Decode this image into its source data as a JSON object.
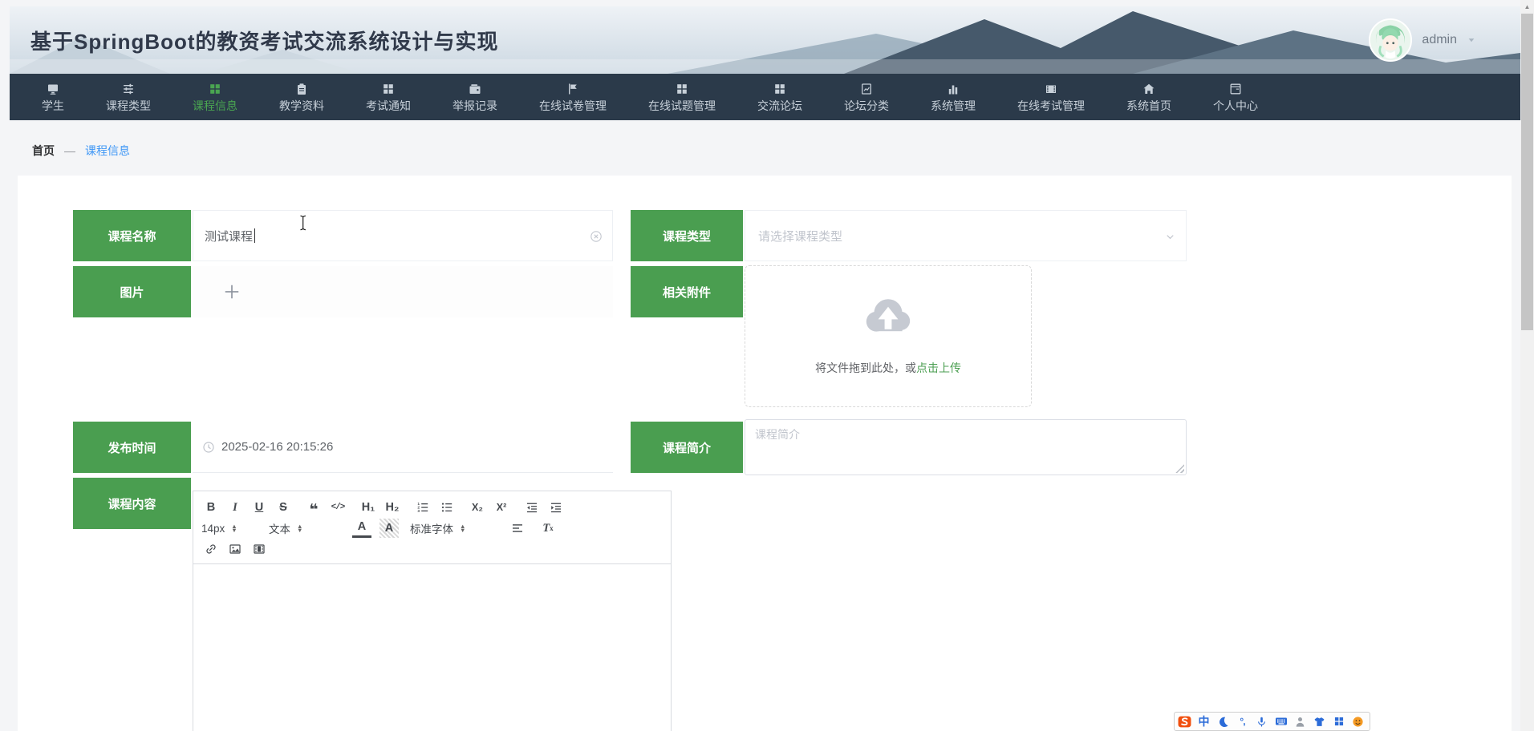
{
  "header": {
    "title": "基于SpringBoot的教资考试交流系统设计与实现",
    "user": {
      "name": "admin",
      "avatar_icon": "avatar",
      "menu_icon": "caret-down"
    }
  },
  "nav": {
    "items": [
      {
        "label": "学生",
        "icon": "monitor",
        "active": false
      },
      {
        "label": "课程类型",
        "icon": "sliders",
        "active": false
      },
      {
        "label": "课程信息",
        "icon": "grid",
        "active": true
      },
      {
        "label": "教学资料",
        "icon": "clipboard",
        "active": false
      },
      {
        "label": "考试通知",
        "icon": "grid",
        "active": false
      },
      {
        "label": "举报记录",
        "icon": "wallet",
        "active": false
      },
      {
        "label": "在线试卷管理",
        "icon": "flag",
        "active": false
      },
      {
        "label": "在线试题管理",
        "icon": "grid",
        "active": false
      },
      {
        "label": "交流论坛",
        "icon": "grid",
        "active": false
      },
      {
        "label": "论坛分类",
        "icon": "docchart",
        "active": false
      },
      {
        "label": "系统管理",
        "icon": "barchart",
        "active": false
      },
      {
        "label": "在线考试管理",
        "icon": "film",
        "active": false
      },
      {
        "label": "系统首页",
        "icon": "home",
        "active": false
      },
      {
        "label": "个人中心",
        "icon": "card",
        "active": false
      }
    ]
  },
  "breadcrumb": {
    "home": "首页",
    "separator": "—",
    "current": "课程信息"
  },
  "form": {
    "course_name": {
      "label": "课程名称",
      "value": "测试课程",
      "clear_icon": "clear"
    },
    "course_type": {
      "label": "课程类型",
      "placeholder": "请选择课程类型",
      "chevron_icon": "chevron-down"
    },
    "image": {
      "label": "图片",
      "plus_icon": "plus"
    },
    "attachment": {
      "label": "相关附件",
      "icon": "cloud-upload",
      "drop_text": "将文件拖到此处，或",
      "upload_link": "点击上传"
    },
    "publish_time": {
      "label": "发布时间",
      "value": "2025-02-16 20:15:26",
      "icon": "clock"
    },
    "course_intro": {
      "label": "课程简介",
      "placeholder": "课程简介"
    },
    "course_content": {
      "label": "课程内容"
    }
  },
  "editor": {
    "toolbar": {
      "bold": "B",
      "italic": "I",
      "underline": "U",
      "strike": "S",
      "blockquote": "❝",
      "code": "</>",
      "header1": "H₁",
      "header2": "H₂",
      "ordered_list_icon": "olist",
      "bullet_list_icon": "ulist",
      "subscript": "X₂",
      "superscript": "X²",
      "outdent_icon": "outdent",
      "indent_icon": "indent",
      "size_value": "14px",
      "header_value": "文本",
      "font_value": "标准字体",
      "color_glyph": "A",
      "background_glyph": "A",
      "align_icon": "align",
      "clean_main": "T",
      "clean_sub": "x",
      "link_icon": "link",
      "image_icon": "image",
      "video_icon": "video"
    }
  },
  "ime": {
    "items": [
      {
        "icon": "sogou"
      },
      {
        "label": "中"
      },
      {
        "icon": "moon"
      },
      {
        "label": "°,"
      },
      {
        "icon": "mic"
      },
      {
        "icon": "keyboard"
      },
      {
        "icon": "person"
      },
      {
        "icon": "tshirt"
      },
      {
        "icon": "grid-blue"
      },
      {
        "icon": "smiley"
      }
    ]
  },
  "colors": {
    "accent_green": "#4a9e50",
    "nav_bg": "#2b3a4a",
    "link_blue": "#3d96f6"
  }
}
